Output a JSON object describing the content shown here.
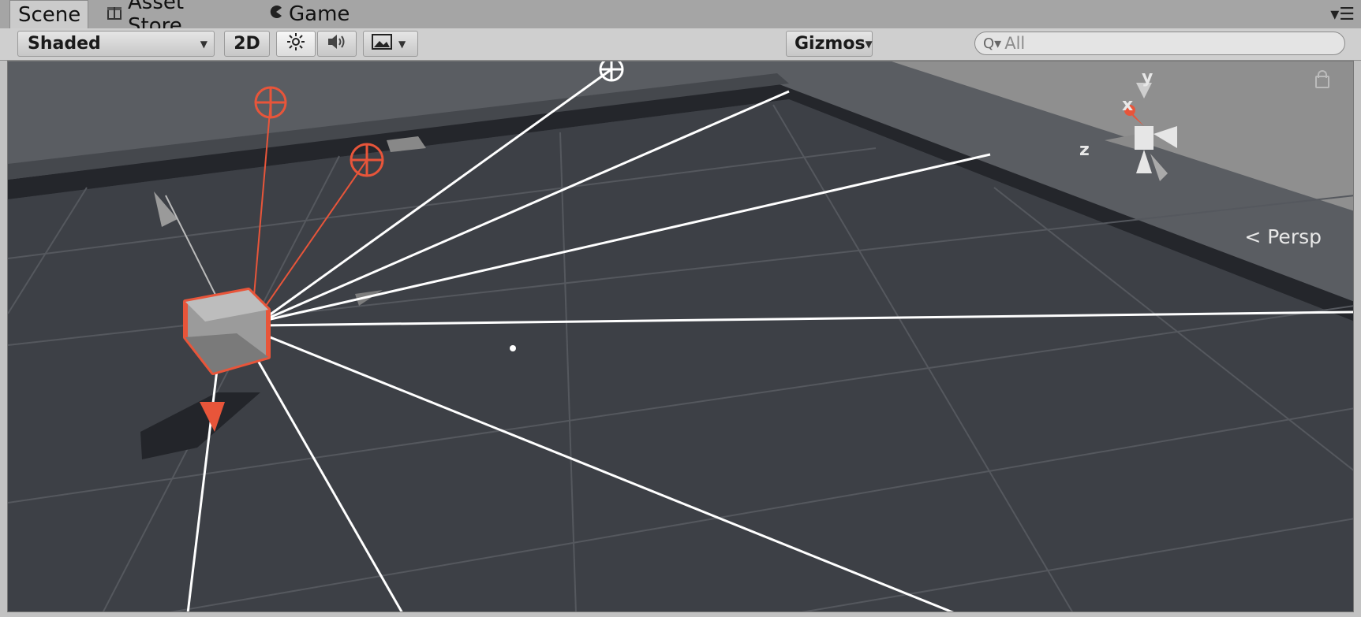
{
  "tabs": [
    {
      "label": "Scene",
      "icon": "scene-icon",
      "active": true
    },
    {
      "label": "Asset Store",
      "icon": "gift-icon",
      "active": false
    },
    {
      "label": "Game",
      "icon": "pacman-icon",
      "active": false
    }
  ],
  "toolbar": {
    "draw_mode": "Shaded",
    "mode_2d": "2D",
    "lighting_icon": "sun-icon",
    "audio_icon": "speaker-icon",
    "effects_icon": "image-icon",
    "gizmos_label": "Gizmos",
    "search_text": "All"
  },
  "scene_gizmo": {
    "axis_y": "y",
    "axis_x": "x",
    "axis_z": "z",
    "projection_label": "Persp"
  },
  "colors": {
    "selection": "#e8553a",
    "viewport_bg": "#3a3d43",
    "ray": "#ffffff"
  }
}
